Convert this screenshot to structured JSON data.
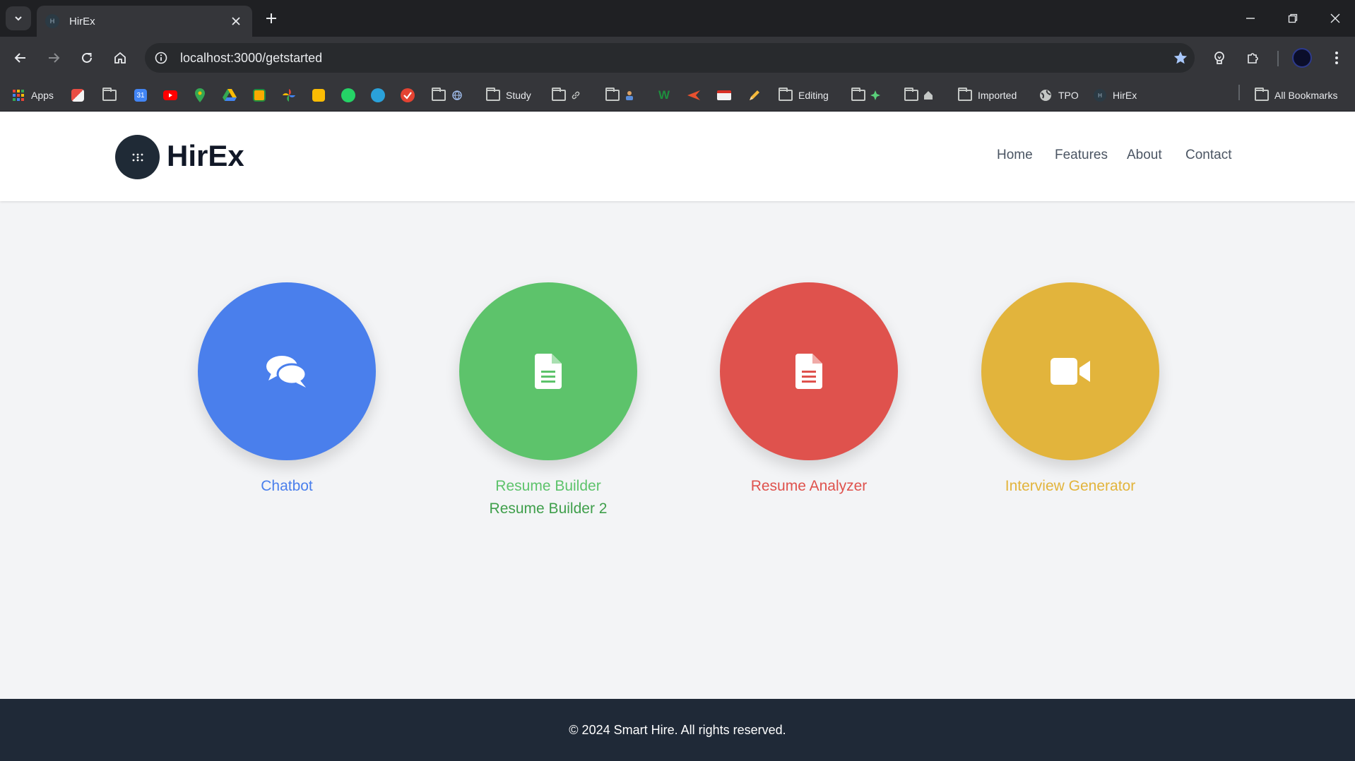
{
  "browser": {
    "tab_title": "HirEx",
    "tab_favicon": "H",
    "url": "localhost:3000/getstarted",
    "bookmarks": {
      "apps": "Apps",
      "study": "Study",
      "editing": "Editing",
      "imported": "Imported",
      "tpo": "TPO",
      "hirex": "HirEx",
      "all_bookmarks": "All Bookmarks"
    }
  },
  "header": {
    "brand": "HirEx",
    "nav": {
      "home": "Home",
      "features": "Features",
      "about": "About",
      "contact": "Contact"
    }
  },
  "features": {
    "chatbot": {
      "label": "Chatbot",
      "color": "#4a7fec",
      "icon": "comments-icon"
    },
    "resume_builder": {
      "label": "Resume Builder",
      "label2": "Resume Builder 2",
      "color": "#5dc36b",
      "label_color": "#5dc36b",
      "label2_color": "#3f9f4b",
      "icon": "file-text-icon"
    },
    "resume_analyzer": {
      "label": "Resume Analyzer",
      "color": "#df524d",
      "icon": "file-text-icon"
    },
    "interview_generator": {
      "label": "Interview Generator",
      "color": "#e2b43c",
      "icon": "video-camera-icon"
    }
  },
  "footer": {
    "text": "© 2024 Smart Hire. All rights reserved."
  }
}
